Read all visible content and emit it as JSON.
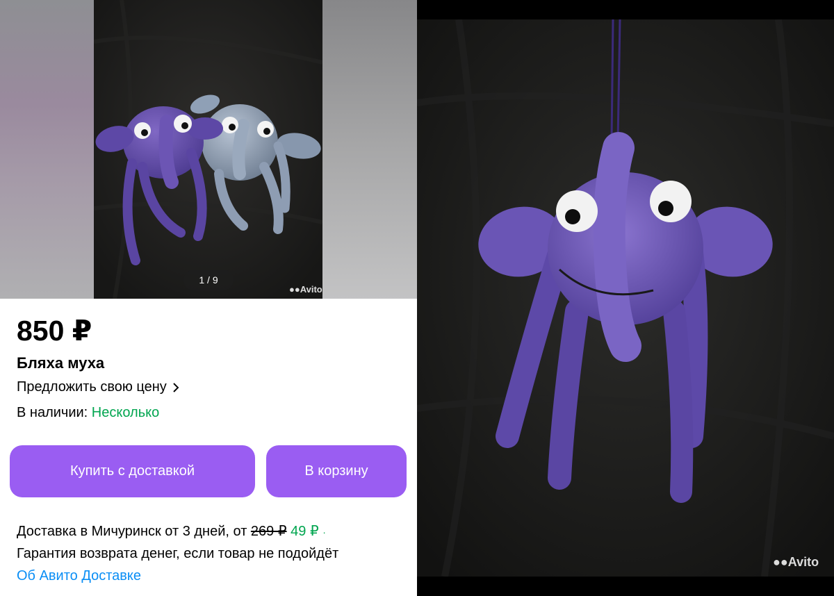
{
  "gallery": {
    "counter": "1 / 9",
    "watermark": "Avito"
  },
  "product": {
    "price": "850 ₽",
    "title": "Бляха муха",
    "offer_price": "Предложить свою цену",
    "stock_label": "В наличии:",
    "stock_value": "Несколько"
  },
  "buttons": {
    "buy": "Купить с доставкой",
    "cart": "В корзину"
  },
  "delivery": {
    "text": "Доставка в Мичуринск от 3 дней, от",
    "old_price": "269 ₽",
    "new_price": "49 ₽",
    "dot": "·",
    "guarantee": "Гарантия возврата денег, если товар не подойдёт",
    "link": "Об Авито Доставке"
  },
  "photo2": {
    "watermark": "Avito"
  },
  "colors": {
    "accent": "#9a5df2",
    "green": "#00a54f",
    "link": "#0a8ef5"
  }
}
